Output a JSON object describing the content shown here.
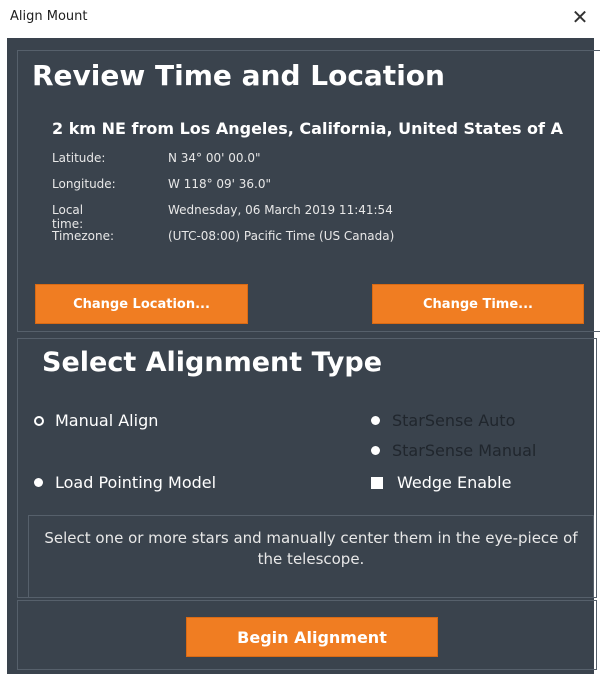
{
  "window": {
    "title": "Align Mount",
    "close_glyph": "✕"
  },
  "review": {
    "heading": "Review Time and Location",
    "location_heading": "2 km NE from Los Angeles, California, United States of A",
    "rows": [
      {
        "label": "Latitude:",
        "value": "N 34° 00' 00.0\""
      },
      {
        "label": "Longitude:",
        "value": "W 118° 09' 36.0\""
      },
      {
        "label": "Local time:",
        "value": "Wednesday, 06 March 2019 11:41:54"
      },
      {
        "label": "Timezone:",
        "value": "(UTC-08:00) Pacific Time (US  Canada)"
      }
    ],
    "change_location_label": "Change Location...",
    "change_time_label": "Change Time..."
  },
  "alignment": {
    "heading": "Select Alignment Type",
    "options": {
      "manual_align": {
        "label": "Manual Align",
        "selected": true
      },
      "load_pointing_model": {
        "label": "Load Pointing Model",
        "selected": false
      },
      "starsense_auto": {
        "label": "StarSense Auto",
        "enabled": false
      },
      "starsense_manual": {
        "label": "StarSense Manual",
        "enabled": false
      },
      "wedge_enable": {
        "label": "Wedge Enable",
        "checked": false
      }
    },
    "hint": "Select one or more stars and manually center them in the eye-piece of the telescope."
  },
  "footer": {
    "begin_label": "Begin Alignment"
  },
  "colors": {
    "background": "#3a434d",
    "accent": "#f07d22",
    "disabled_text": "#20262d"
  }
}
